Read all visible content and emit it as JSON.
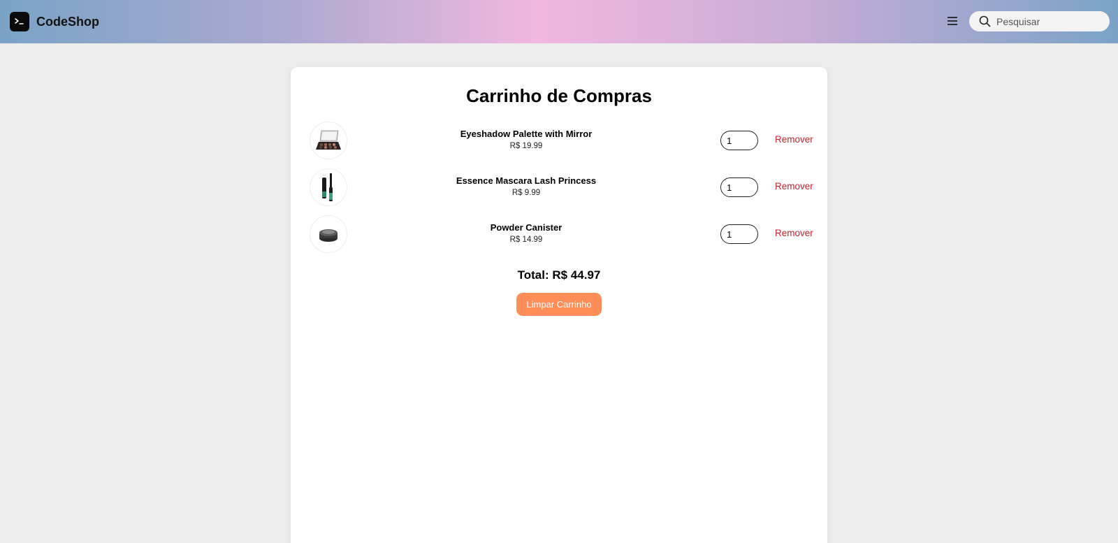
{
  "header": {
    "brand": "CodeShop",
    "search_placeholder": "Pesquisar"
  },
  "cart": {
    "title": "Carrinho de Compras",
    "items": [
      {
        "name": "Eyeshadow Palette with Mirror",
        "price": "R$ 19.99",
        "quantity": "1",
        "remove_label": "Remover",
        "image": "eyeshadow-palette"
      },
      {
        "name": "Essence Mascara Lash Princess",
        "price": "R$ 9.99",
        "quantity": "1",
        "remove_label": "Remover",
        "image": "mascara"
      },
      {
        "name": "Powder Canister",
        "price": "R$ 14.99",
        "quantity": "1",
        "remove_label": "Remover",
        "image": "powder-canister"
      }
    ],
    "total": "Total: R$ 44.97",
    "clear_label": "Limpar Carrinho"
  },
  "colors": {
    "accent_button": "#ff8d57",
    "remove_link": "#c8232c"
  }
}
